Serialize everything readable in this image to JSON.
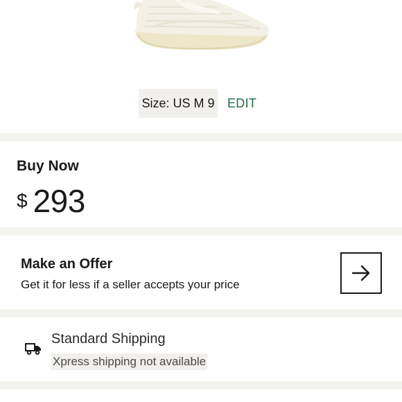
{
  "product": {
    "image_alt": "sneaker-image"
  },
  "size": {
    "label": "Size: US M 9",
    "edit_label": "EDIT"
  },
  "buy_now": {
    "heading": "Buy Now",
    "currency": "$",
    "price": "293"
  },
  "offer": {
    "title": "Make an Offer",
    "subtitle": "Get it for less if a seller accepts your price",
    "arrow_icon": "arrow-right-icon"
  },
  "shipping": {
    "icon": "truck-icon",
    "title": "Standard Shipping",
    "note": "Xpress shipping not available"
  },
  "colors": {
    "accent": "#1f6b45",
    "divider": "#f4f3ef",
    "chip_bg": "#f1f0ec"
  }
}
